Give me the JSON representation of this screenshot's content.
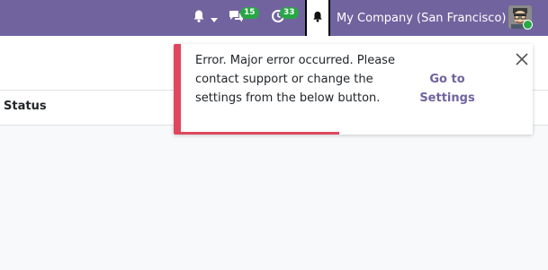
{
  "navbar": {
    "company_name": "My Company (San Francisco)",
    "messages_count": "15",
    "activities_count": "33",
    "icons": [
      "bell-icon",
      "chat-icon",
      "clock-icon",
      "active-bell-icon",
      "avatar"
    ]
  },
  "table": {
    "columns": [
      "Status"
    ]
  },
  "notification": {
    "message": "Error. Major error occurred. Please contact support or change the settings from the below button.",
    "action_label": "Go to Settings",
    "type": "danger",
    "progress_fraction": 0.45,
    "accent_color": "#e0475f"
  },
  "colors": {
    "navbar_bg": "#71639e",
    "badge": "#28a745",
    "action_text": "#71639e"
  }
}
